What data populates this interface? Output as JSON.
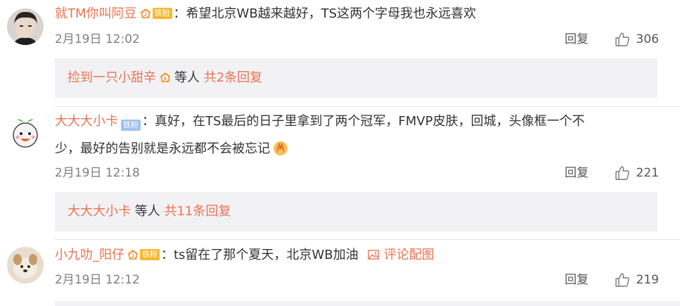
{
  "comments": [
    {
      "username": "就TM你叫阿豆",
      "medal_level": "2",
      "fan_badge": "铁粉",
      "separator": "：",
      "text": "希望北京WB越来越好，TS这两个字母我也永远喜欢",
      "time": "2月19日 12:02",
      "reply_label": "回复",
      "like_count": "306",
      "replies": {
        "user": "捡到一只小甜辛",
        "medal_level": "6",
        "suffix": "等人",
        "count_label": "共2条回复"
      }
    },
    {
      "username": "大大大小卡",
      "fan_badge": "铁粉",
      "separator": "：",
      "text_line1": "真好，在TS最后的日子里拿到了两个冠军，FMVP皮肤，回城，头像框一个不",
      "text_line2": "少，最好的告别就是永远都不会被忘记",
      "time": "2月19日 12:18",
      "reply_label": "回复",
      "like_count": "221",
      "replies": {
        "user": "大大大小卡",
        "suffix": "等人",
        "count_label": "共11条回复"
      }
    },
    {
      "username": "小九叻_阳仔",
      "medal_level": "2",
      "fan_badge": "铁粉",
      "separator": "：",
      "text": "ts留在了那个夏天，北京WB加油",
      "pic_link": "评论配图",
      "time": "2月19日 12:12",
      "reply_label": "回复",
      "like_count": "219"
    }
  ],
  "colors": {
    "link": "#eb7350",
    "fan_gold": "#f7b92f",
    "fan_blue": "#9fc1ee",
    "reply_bg": "#f2f2f5",
    "meta_text": "#808080"
  },
  "icons": {
    "like": "thumbs-up-icon",
    "picture": "image-icon",
    "medal": "fan-medal-icon",
    "emoji": "praying-hands-emoji"
  }
}
